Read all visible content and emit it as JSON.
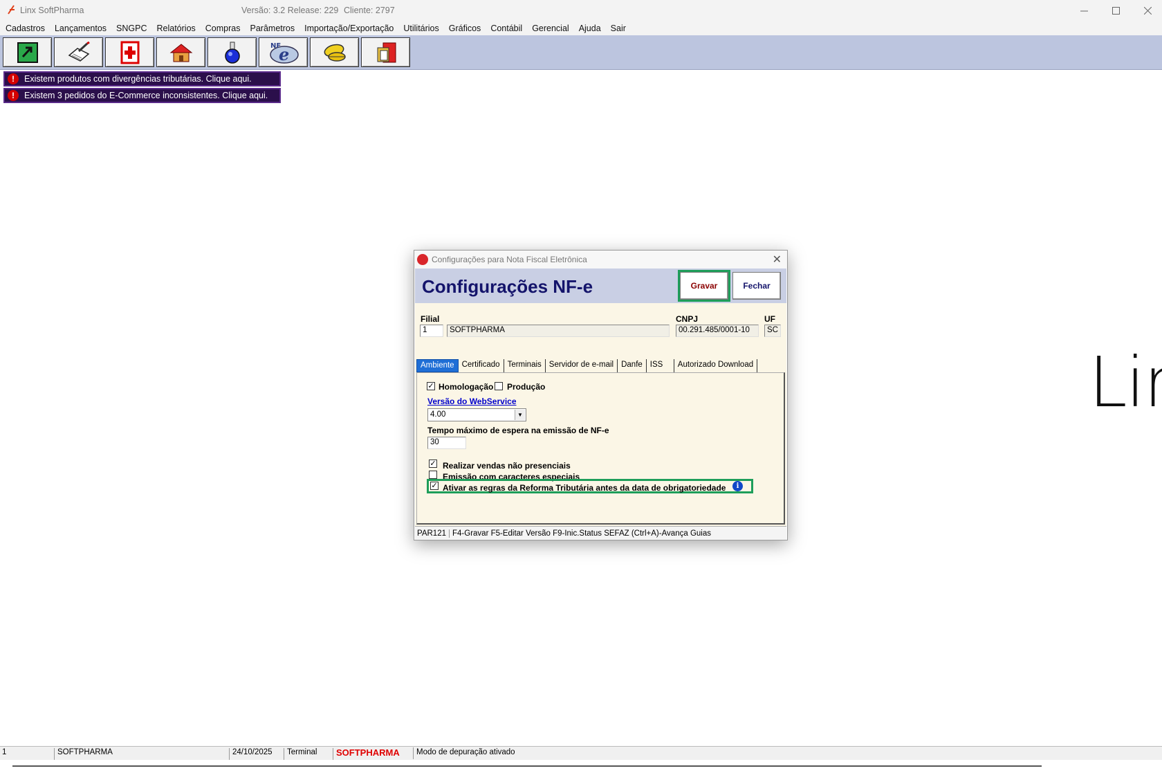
{
  "window": {
    "title": "Linx SoftPharma",
    "version": "Versão: 3.2 Release: 229",
    "client": "Cliente: 2797"
  },
  "menu": [
    "Cadastros",
    "Lançamentos",
    "SNGPC",
    "Relatórios",
    "Compras",
    "Parâmetros",
    "Importação/Exportação",
    "Utilitários",
    "Gráficos",
    "Contábil",
    "Gerencial",
    "Ajuda",
    "Sair"
  ],
  "toolbar_icons": [
    "refresh-cash-icon",
    "pen-document-icon",
    "pharmacy-cross-icon",
    "store-house-icon",
    "flask-icon",
    "nfe-icon",
    "pills-icon",
    "book-exit-icon"
  ],
  "alerts": [
    "Existem produtos com divergências tributárias. Clique aqui.",
    "Existem 3 pedidos do E-Commerce inconsistentes. Clique aqui."
  ],
  "background_logo": "Lir",
  "dialog": {
    "title": "Configurações para Nota Fiscal Eletrônica",
    "heading": "Configurações NF-e",
    "gravar": "Gravar",
    "fechar": "Fechar",
    "filial_label": "Filial",
    "filial_code": "1",
    "filial_name": "SOFTPHARMA",
    "cnpj_label": "CNPJ",
    "cnpj": "00.291.485/0001-10",
    "uf_label": "UF",
    "uf": "SC",
    "tabs": [
      "Ambiente",
      "Certificado",
      "Terminais",
      "Servidor de e-mail",
      "Danfe",
      "ISS",
      "Autorizado Download"
    ],
    "homologacao": "Homologação",
    "producao": "Produção",
    "webservice_label": "Versão do WebService",
    "webservice_value": "4.00",
    "tempo_label": "Tempo máximo de espera na emissão de NF-e",
    "tempo_value": "30",
    "opt_vendas": "Realizar vendas não presenciais",
    "opt_caracteres": "Emissão com caracteres especiais",
    "opt_reforma": "Ativar as regras da Reforma Tributária antes da data de obrigatoriedade",
    "status_code": "PAR121",
    "status_keys": "F4-Gravar  F5-Editar Versão  F9-Inic.Status SEFAZ  (Ctrl+A)-Avança Guias"
  },
  "statusbar": {
    "field1": "1",
    "company": "SOFTPHARMA",
    "date": "24/10/2025",
    "terminal": "Terminal",
    "brand": "SOFTPHARMA",
    "mode": "Modo de depuração ativado"
  }
}
